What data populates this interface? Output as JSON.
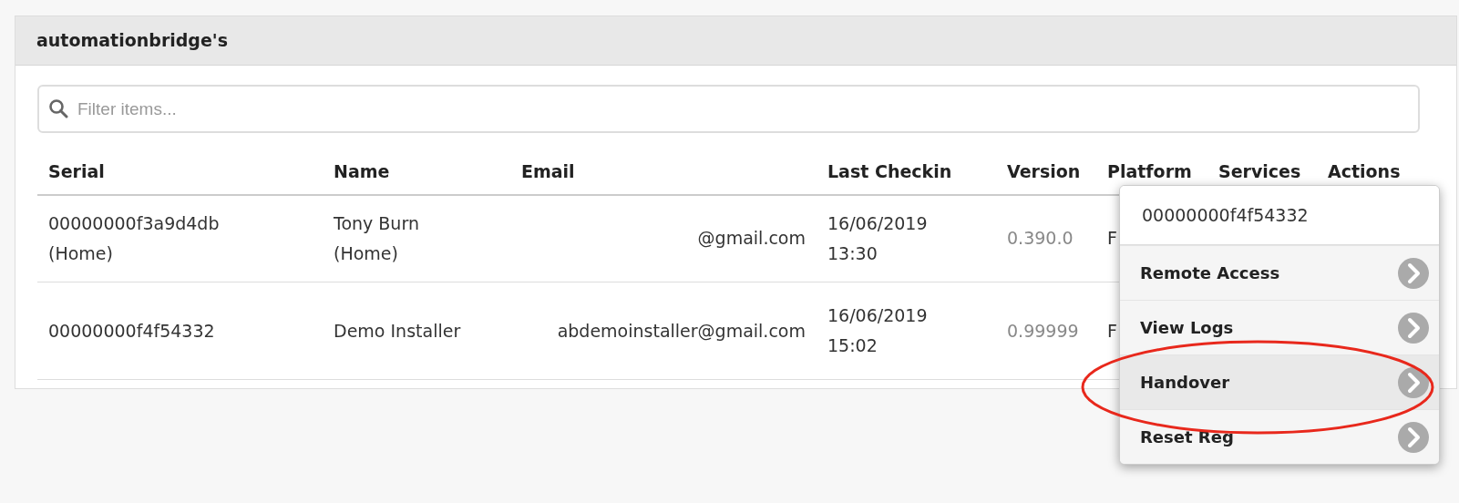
{
  "panel": {
    "title": "automationbridge's"
  },
  "filter": {
    "placeholder": "Filter items..."
  },
  "table": {
    "columns": [
      "Serial",
      "Name",
      "Email",
      "Last Checkin",
      "Version",
      "Platform",
      "Services",
      "Actions"
    ],
    "rows": [
      {
        "cells": [
          "00000000f3a9d4db\n(Home)",
          "Tony Burn\n(Home)",
          "@gmail.com",
          "16/06/2019\n13:30",
          "0.390.0",
          "F"
        ]
      },
      {
        "cells": [
          "00000000f4f54332",
          "Demo Installer",
          "abdemoinstaller@gmail.com",
          "16/06/2019\n15:02",
          "0.99999",
          "F"
        ]
      }
    ]
  },
  "menu": {
    "title": "00000000f4f54332",
    "items": [
      {
        "label": "Remote Access",
        "selected": false
      },
      {
        "label": "View Logs",
        "selected": false
      },
      {
        "label": "Handover",
        "selected": true
      },
      {
        "label": "Reset Reg",
        "selected": false
      }
    ]
  },
  "annotation": {
    "kind": "ellipse"
  }
}
